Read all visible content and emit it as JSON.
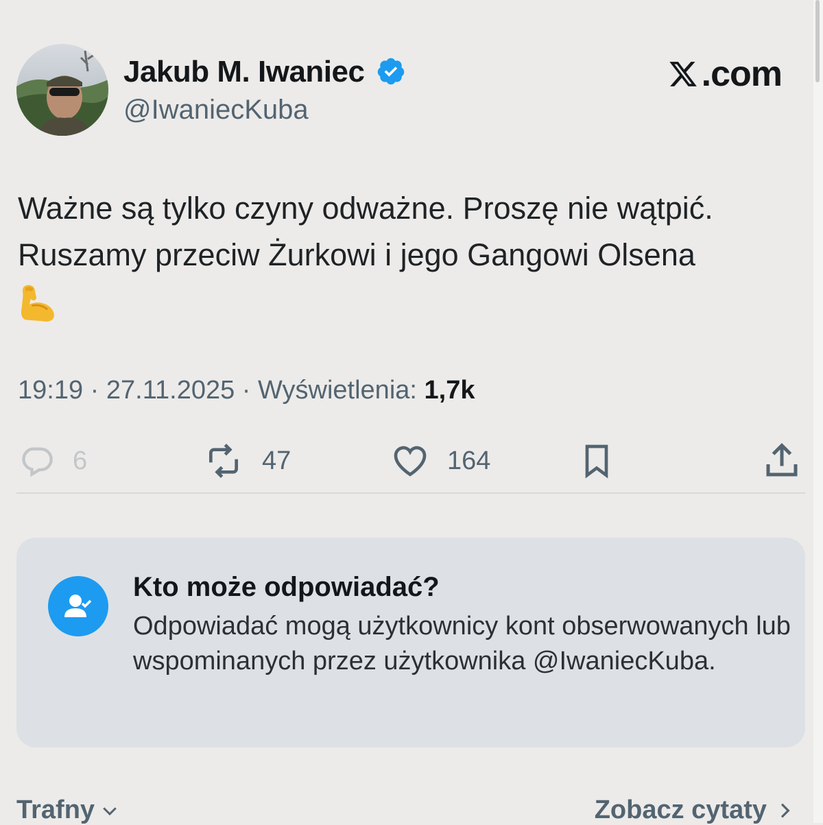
{
  "author": {
    "name": "Jakub M. Iwaniec",
    "handle": "@IwaniecKuba",
    "verified": true
  },
  "site_logo": ".com",
  "tweet": {
    "lines": [
      "Ważne są tylko czyny odważne. Proszę nie wątpić.",
      "Ruszamy przeciw Żurkowi i jego Gangowi Olsena"
    ],
    "emoji": "flexed-biceps-icon"
  },
  "meta": {
    "time_date": "19:19 · 27.11.2025 · Wyświetlenia: ",
    "views": "1,7k"
  },
  "actions": {
    "replies": "6",
    "reposts": "47",
    "likes": "164"
  },
  "reply_settings": {
    "title": "Kto może odpowiadać?",
    "description": "Odpowiadać mogą użytkownicy kont obserwowanych lub wspominanych przez użytkownika @IwaniecKuba."
  },
  "footer": {
    "sort_label": "Trafny",
    "quotes_label": "Zobacz cytaty"
  },
  "colors": {
    "background": "#ecebe9",
    "accent": "#1d9bf0",
    "muted": "#536471",
    "card": "#dde1e5"
  }
}
